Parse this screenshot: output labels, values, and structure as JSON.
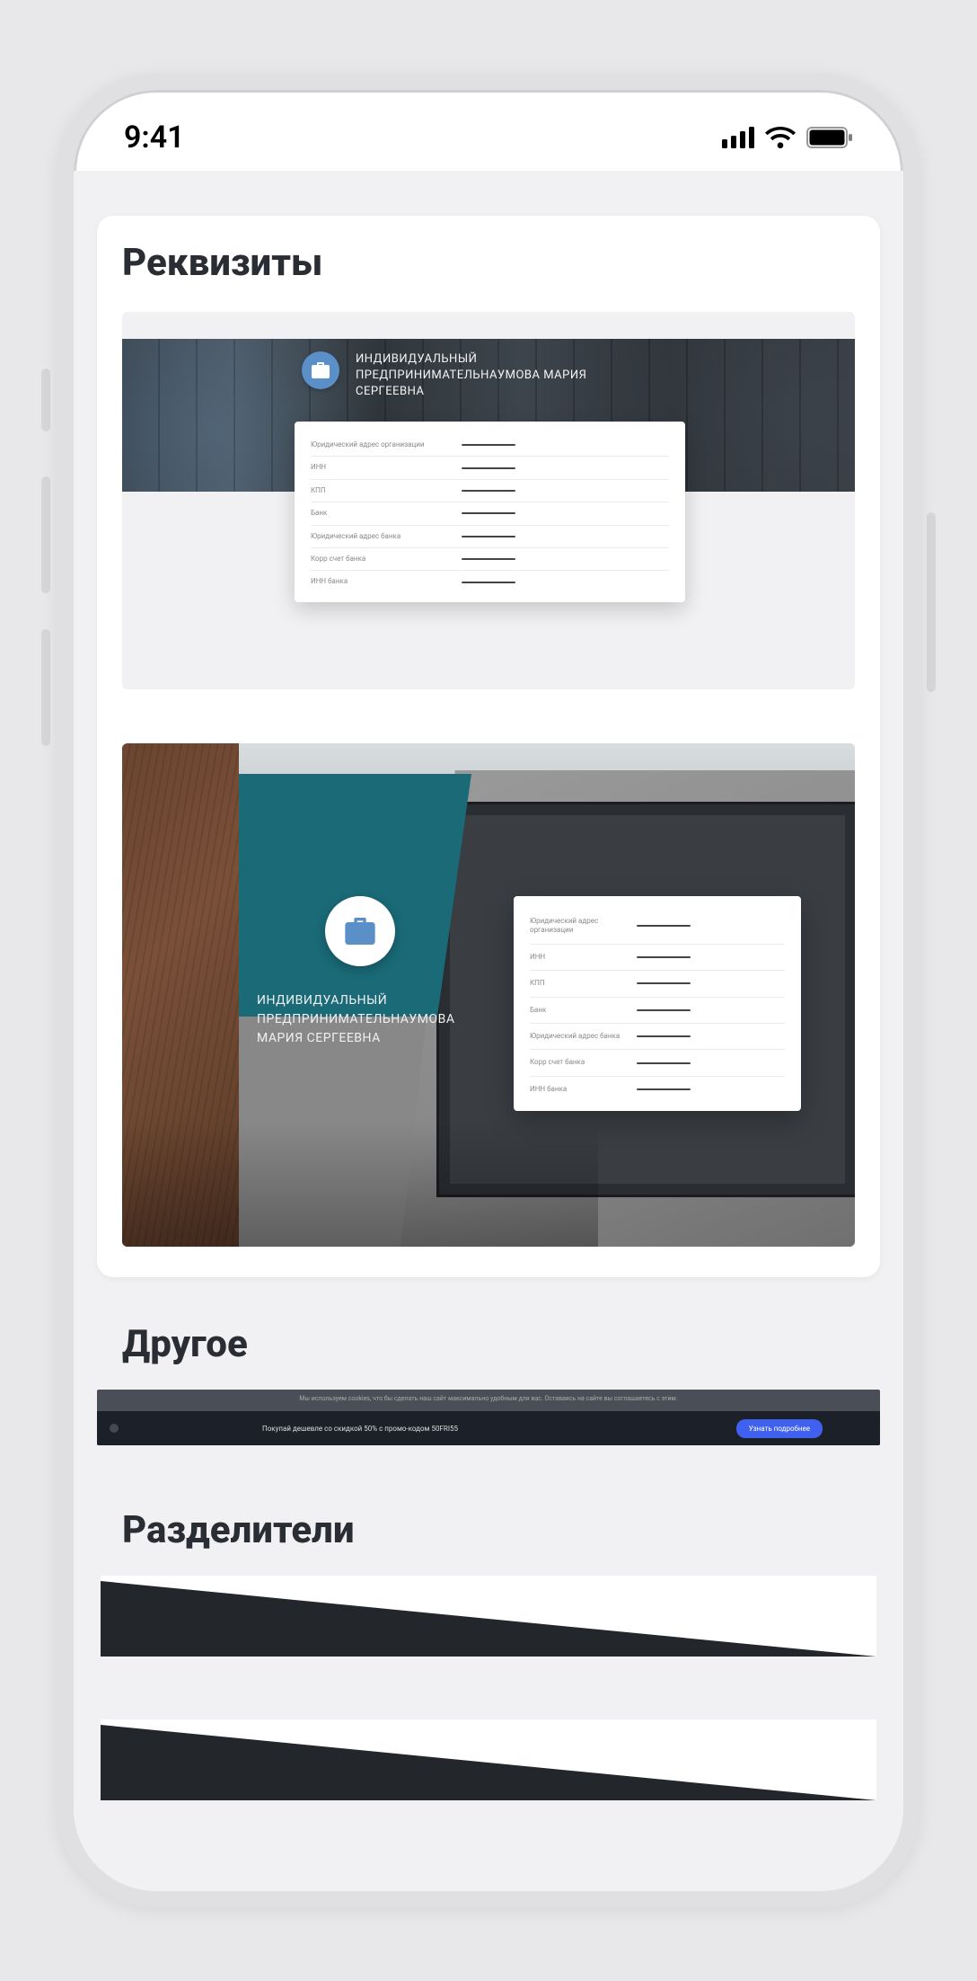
{
  "status_bar": {
    "time": "9:41"
  },
  "sections": {
    "requisites": {
      "title": "Реквизиты",
      "preview1": {
        "entrepreneur_title": "ИНДИВИДУАЛЬНЫЙ ПРЕДПРИНИМАТЕЛЬНАУМОВА МАРИЯ СЕРГЕЕВНА",
        "rows": [
          "Юридический адрес организации",
          "ИНН",
          "КПП",
          "Банк",
          "Юридический адрес банка",
          "Корр счет банка",
          "ИНН банка"
        ]
      },
      "preview2": {
        "entrepreneur_title": "ИНДИВИДУАЛЬНЫЙ ПРЕДПРИНИМАТЕЛЬНАУМОВА МАРИЯ СЕРГЕЕВНА",
        "rows": [
          "Юридический адрес организации",
          "ИНН",
          "КПП",
          "Банк",
          "Юридический адрес банка",
          "Корр счет банка",
          "ИНН банка"
        ]
      }
    },
    "other": {
      "title": "Другое",
      "top_text": "Мы используем cookies, что бы сделать наш сайт максимально удобным для вас. Оставаясь на сайте вы соглашаетесь с этим.",
      "promo_text": "Покупай дешевле со скидкой 50% с промо-кодом 50FRI55",
      "button": "Узнать подробнее"
    },
    "dividers": {
      "title": "Разделители"
    }
  }
}
